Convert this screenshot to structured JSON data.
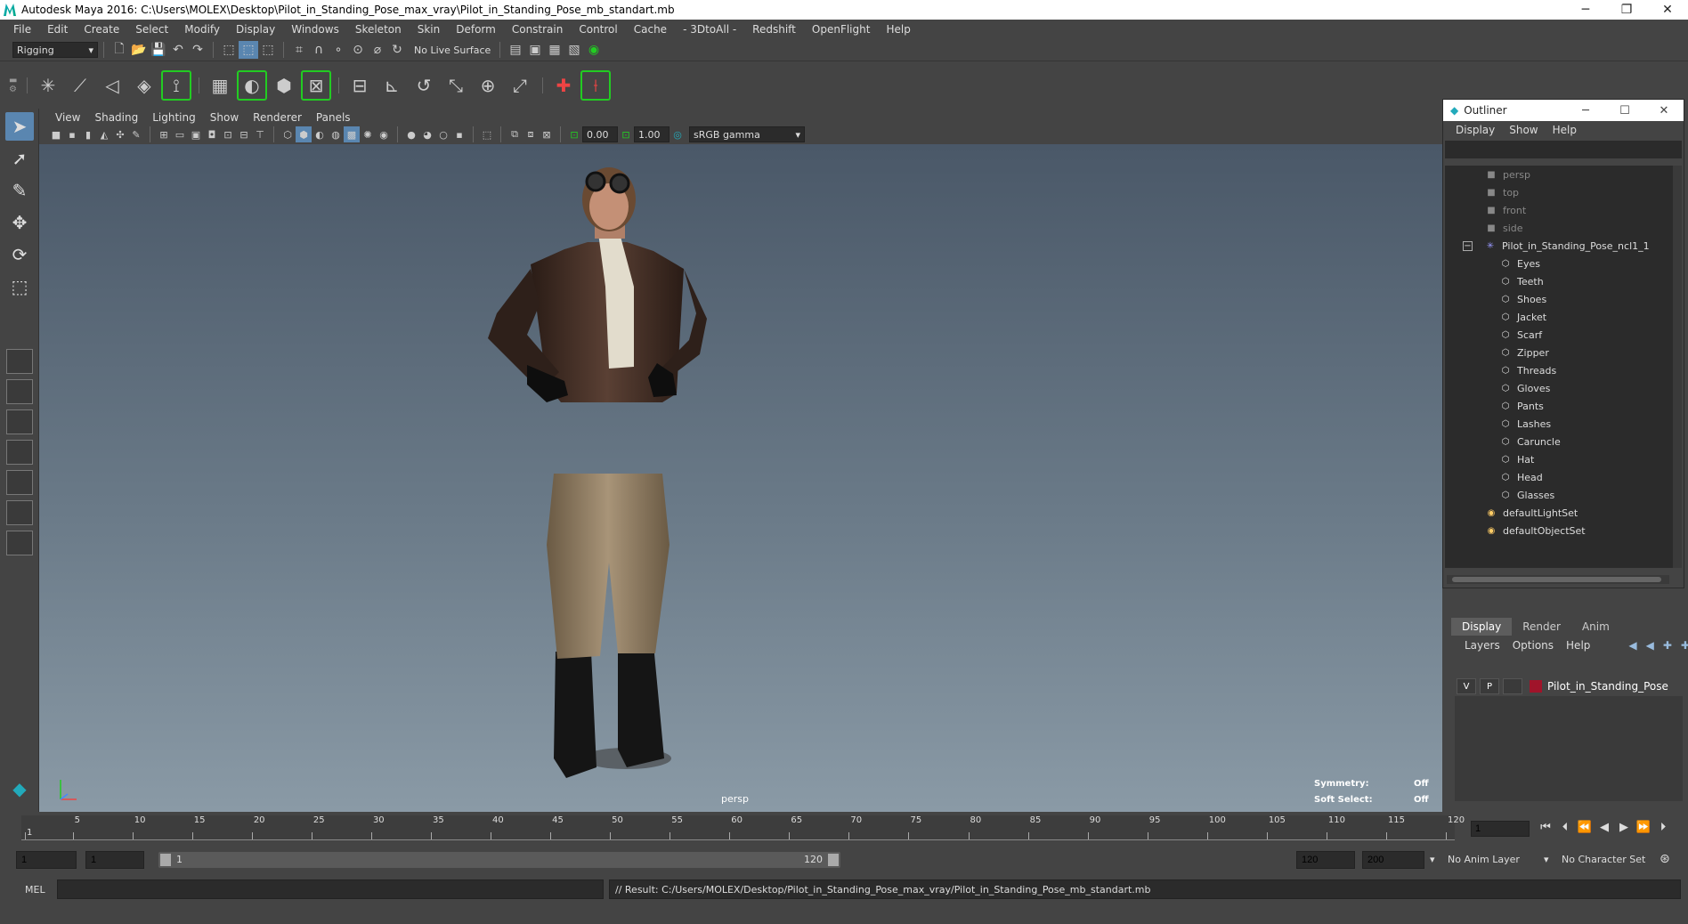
{
  "window": {
    "title": "Autodesk Maya 2016: C:\\Users\\MOLEX\\Desktop\\Pilot_in_Standing_Pose_max_vray\\Pilot_in_Standing_Pose_mb_standart.mb",
    "minimize": "─",
    "restore": "❐",
    "close": "✕"
  },
  "menubar": [
    "File",
    "Edit",
    "Create",
    "Select",
    "Modify",
    "Display",
    "Windows",
    "Skeleton",
    "Skin",
    "Deform",
    "Constrain",
    "Control",
    "Cache",
    "- 3DtoAll -",
    "Redshift",
    "OpenFlight",
    "Help"
  ],
  "statusline": {
    "menuset": "Rigging",
    "live_surface": "No Live Surface"
  },
  "panel": {
    "menus": [
      "View",
      "Shading",
      "Lighting",
      "Show",
      "Renderer",
      "Panels"
    ],
    "near": "0.00",
    "far": "1.00",
    "color_space": "sRGB gamma"
  },
  "viewport": {
    "camera": "persp",
    "symmetry_label": "Symmetry:",
    "symmetry_value": "Off",
    "soft_select_label": "Soft Select:",
    "soft_select_value": "Off"
  },
  "outliner": {
    "title": "Outliner",
    "menus": [
      "Display",
      "Show",
      "Help"
    ],
    "cameras": [
      "persp",
      "top",
      "front",
      "side"
    ],
    "root": "Pilot_in_Standing_Pose_ncl1_1",
    "children": [
      "Eyes",
      "Teeth",
      "Shoes",
      "Jacket",
      "Scarf",
      "Zipper",
      "Threads",
      "Gloves",
      "Pants",
      "Lashes",
      "Caruncle",
      "Hat",
      "Head",
      "Glasses"
    ],
    "sets": [
      "defaultLightSet",
      "defaultObjectSet"
    ]
  },
  "layer_editor": {
    "tabs": [
      "Display",
      "Render",
      "Anim"
    ],
    "active_tab": "Display",
    "menus": [
      "Layers",
      "Options",
      "Help"
    ],
    "layer": {
      "v": "V",
      "p": "P",
      "name": "Pilot_in_Standing_Pose",
      "color": "#a0142a"
    }
  },
  "timeline": {
    "ticks": [
      "1",
      "5",
      "10",
      "15",
      "20",
      "25",
      "30",
      "35",
      "40",
      "45",
      "50",
      "55",
      "60",
      "65",
      "70",
      "75",
      "80",
      "85",
      "90",
      "95",
      "100",
      "105",
      "110",
      "115",
      "120"
    ],
    "current_frame": "1"
  },
  "range": {
    "start": "1",
    "inner_start": "1",
    "bar_start": "1",
    "bar_end": "120",
    "end": "120",
    "total_end": "200",
    "anim_layer": "No Anim Layer",
    "char_set": "No Character Set"
  },
  "command": {
    "label": "MEL",
    "result": "// Result: C:/Users/MOLEX/Desktop/Pilot_in_Standing_Pose_max_vray/Pilot_in_Standing_Pose_mb_standart.mb"
  }
}
